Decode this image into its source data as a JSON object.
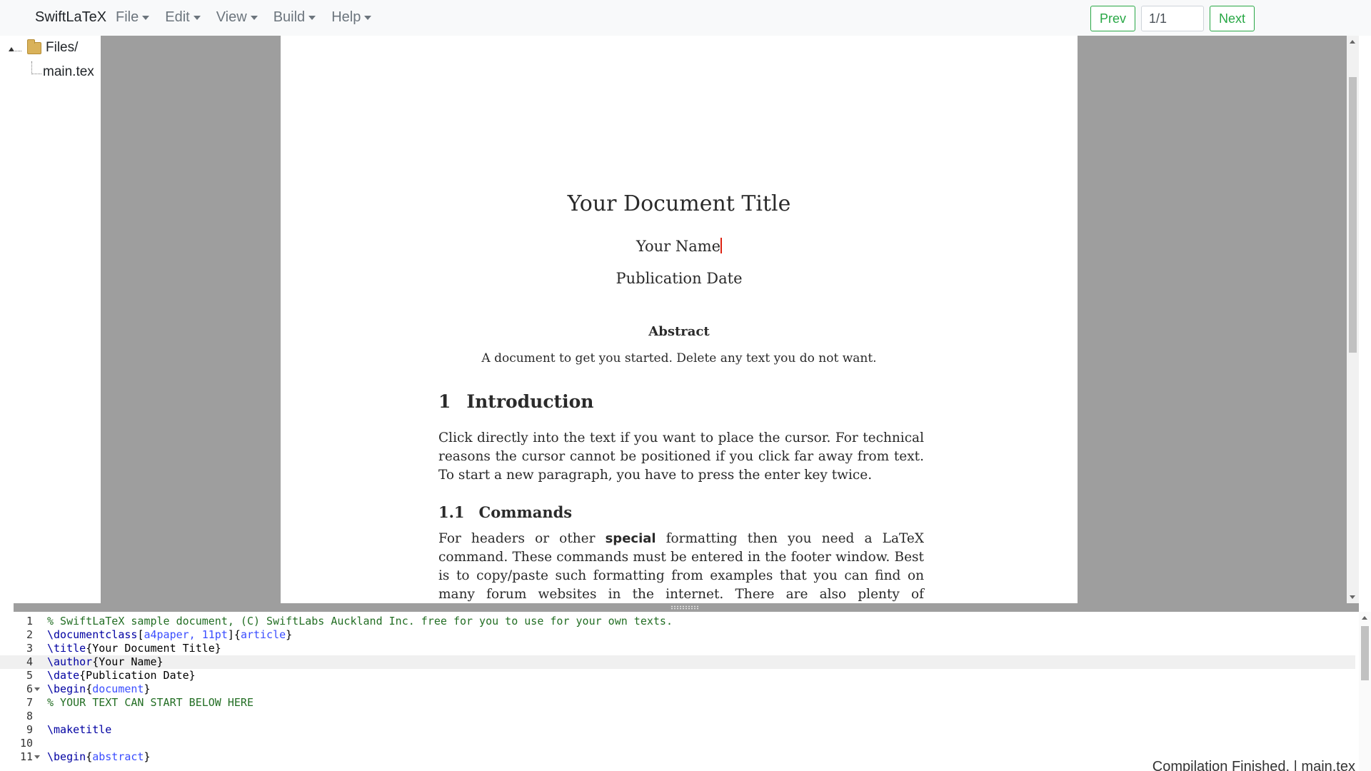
{
  "app": {
    "brand": "SwiftLaTeX"
  },
  "menu": [
    {
      "label": "File"
    },
    {
      "label": "Edit"
    },
    {
      "label": "View"
    },
    {
      "label": "Build"
    },
    {
      "label": "Help"
    }
  ],
  "pager": {
    "prev_label": "Prev",
    "page_value": "1/1",
    "next_label": "Next"
  },
  "filetree": {
    "root": "Files/",
    "files": [
      "main.tex"
    ]
  },
  "document": {
    "title": "Your Document Title",
    "author": "Your Name",
    "date": "Publication Date",
    "abstract_heading": "Abstract",
    "abstract_text": "A document to get you started. Delete any text you do not want.",
    "section_number": "1",
    "section_title": "Introduction",
    "intro_paragraph": "Click directly into the text if you want to place the cursor. For technical reasons the cursor cannot be positioned if you click far away from text. To start a new paragraph, you have to press the enter key twice.",
    "subsection_number": "1.1",
    "subsection_title": "Commands",
    "cmd_para_1": "For headers or other ",
    "cmd_para_special": "special",
    "cmd_para_2": " formatting then you need a LaTeX command. These commands must be entered in the footer window. Best is to copy/paste such formatting from examples that you can find on many forum websites in the internet. There are also plenty of reasonable LaTeX tutorials around."
  },
  "editor": {
    "active_line": 4,
    "lines": [
      {
        "n": "1",
        "parts": [
          [
            "c-comment",
            "% SwiftLaTeX sample document, (C) SwiftLabs Auckland Inc. free for you to use for your own texts."
          ]
        ]
      },
      {
        "n": "2",
        "parts": [
          [
            "c-cmd",
            "\\documentclass"
          ],
          [
            "",
            "["
          ],
          [
            "c-arg",
            "a4paper, 11pt"
          ],
          [
            "",
            "]{"
          ],
          [
            "c-arg",
            "article"
          ],
          [
            "",
            "}"
          ]
        ]
      },
      {
        "n": "3",
        "parts": [
          [
            "c-cmd",
            "\\title"
          ],
          [
            "",
            "{Your Document Title}"
          ]
        ]
      },
      {
        "n": "4",
        "parts": [
          [
            "c-cmd",
            "\\author"
          ],
          [
            "",
            "{Your Name}"
          ]
        ]
      },
      {
        "n": "5",
        "parts": [
          [
            "c-cmd",
            "\\date"
          ],
          [
            "",
            "{Publication Date}"
          ]
        ]
      },
      {
        "n": "6",
        "fold": true,
        "parts": [
          [
            "c-cmd",
            "\\begin"
          ],
          [
            "",
            "{"
          ],
          [
            "c-arg",
            "document"
          ],
          [
            "",
            "}"
          ]
        ]
      },
      {
        "n": "7",
        "parts": [
          [
            "c-comment",
            "% YOUR TEXT CAN START BELOW HERE"
          ]
        ]
      },
      {
        "n": "8",
        "parts": []
      },
      {
        "n": "9",
        "parts": [
          [
            "c-cmd",
            "\\maketitle"
          ]
        ]
      },
      {
        "n": "10",
        "parts": []
      },
      {
        "n": "11",
        "fold": true,
        "parts": [
          [
            "c-cmd",
            "\\begin"
          ],
          [
            "",
            "{"
          ],
          [
            "c-arg",
            "abstract"
          ],
          [
            "",
            "}"
          ]
        ]
      }
    ],
    "status": "Compilation Finished. | main.tex"
  },
  "colors": {
    "accent_green": "#28a745",
    "viewer_bg": "#9e9e9e"
  },
  "icons": {
    "folder": "folder-icon",
    "tree_toggle": "tree-collapse-icon"
  }
}
